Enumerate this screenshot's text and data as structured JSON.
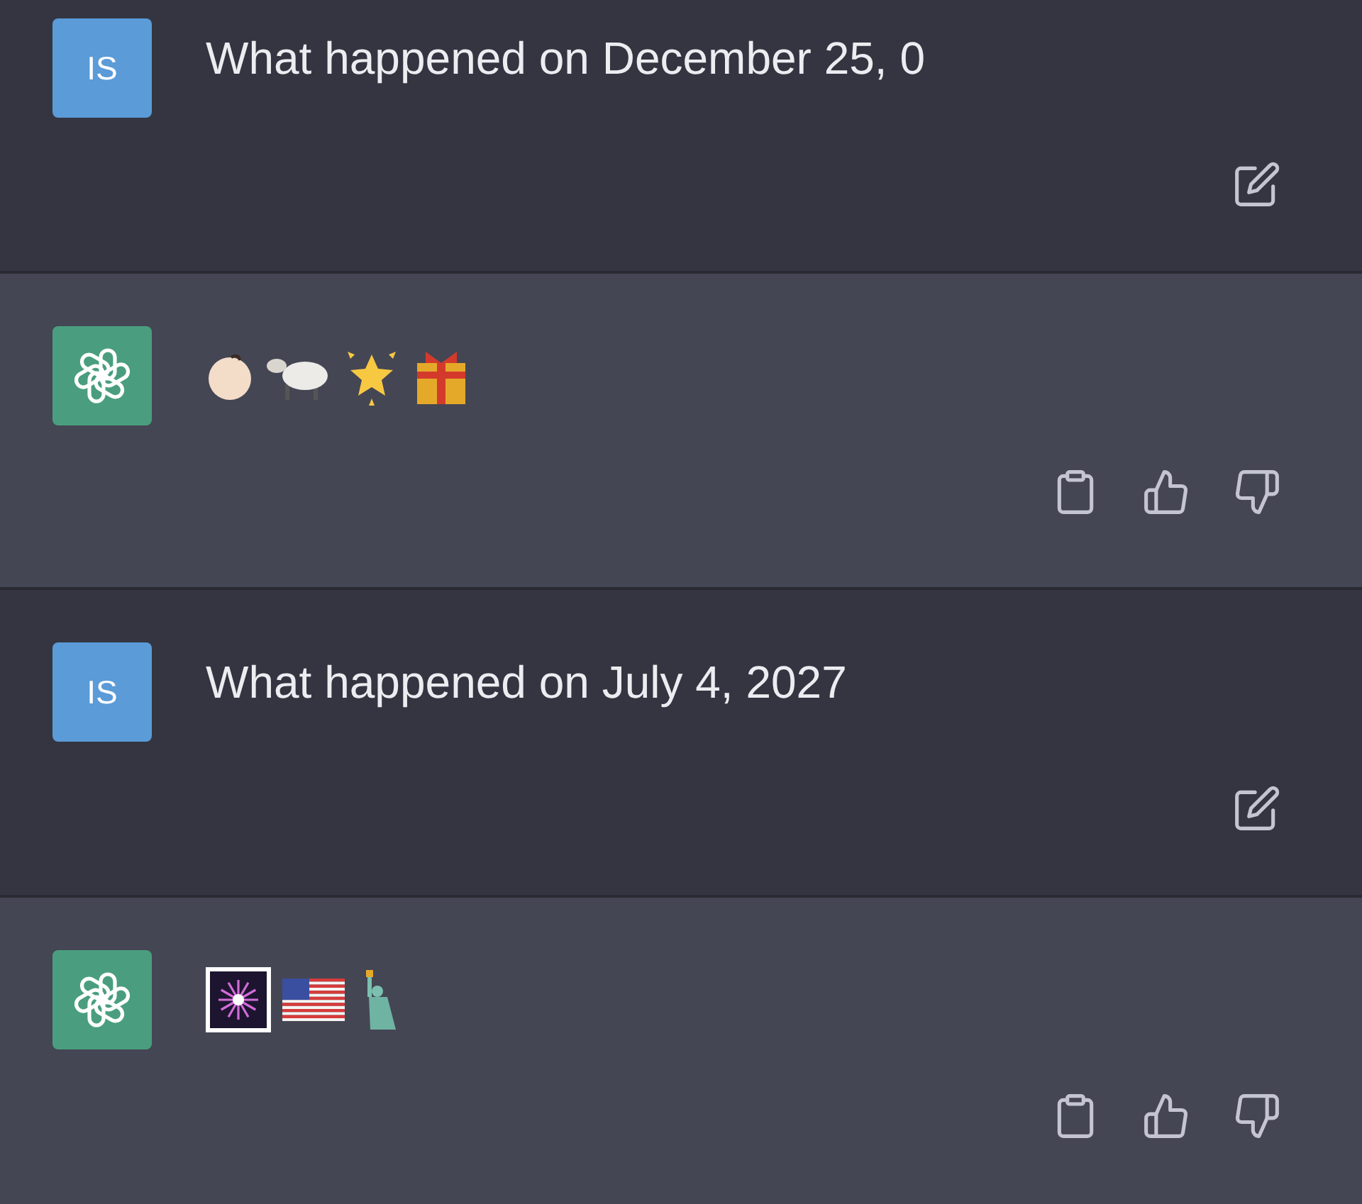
{
  "messages": [
    {
      "kind": "user",
      "avatar": "IS",
      "text": "What happened on December 25, 0",
      "actions": [
        {
          "kind": "edit"
        }
      ]
    },
    {
      "kind": "assistant",
      "emojis": [
        {
          "kind": "baby"
        },
        {
          "kind": "sheep"
        },
        {
          "kind": "star"
        },
        {
          "kind": "gift"
        }
      ],
      "actions": [
        {
          "kind": "copy"
        },
        {
          "kind": "like"
        },
        {
          "kind": "dislike"
        }
      ]
    },
    {
      "kind": "user",
      "avatar": "IS",
      "text": "What happened on July 4, 2027",
      "actions": [
        {
          "kind": "edit"
        }
      ]
    },
    {
      "kind": "assistant",
      "emojis": [
        {
          "kind": "fireworks"
        },
        {
          "kind": "flag"
        },
        {
          "kind": "statue"
        }
      ],
      "actions": [
        {
          "kind": "copy"
        },
        {
          "kind": "like"
        },
        {
          "kind": "dislike"
        }
      ]
    }
  ]
}
